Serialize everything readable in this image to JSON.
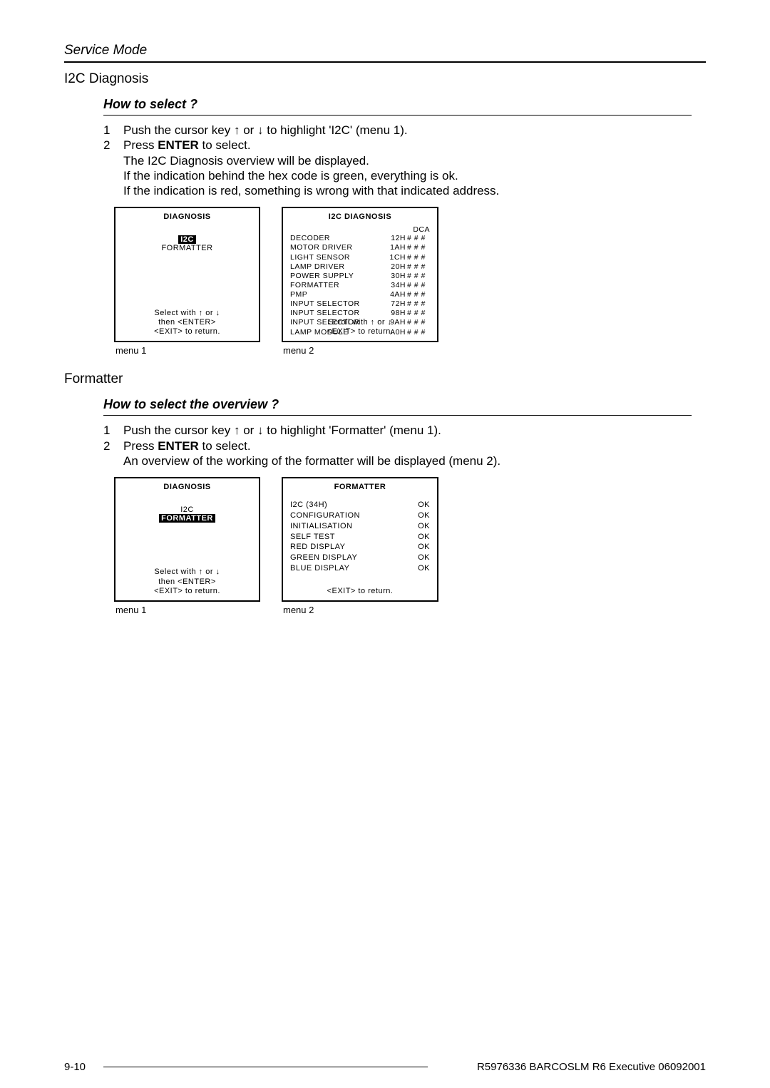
{
  "header": {
    "service_mode": "Service Mode"
  },
  "i2c": {
    "title": "I2C Diagnosis",
    "subheading": "How to select ?",
    "steps": {
      "s1_num": "1",
      "s1_pre": "Push the cursor key ",
      "s1_mid": " or ",
      "s1_post": " to highlight 'I2C' (menu 1).",
      "s2_num": "2",
      "s2_a": "Press ",
      "s2_enter": "ENTER",
      "s2_b": " to select.",
      "s2_line2": "The I2C Diagnosis overview will be displayed.",
      "s2_line3": "If the indication behind the hex code is green, everything is ok.",
      "s2_line4": "If the indication is red, something is wrong with that indicated address."
    },
    "menu1": {
      "title": "DIAGNOSIS",
      "item_sel": "I2C",
      "item2": "FORMATTER",
      "footer_l1_a": "Select with ",
      "footer_l1_b": " or ",
      "footer_l2": "then <ENTER>",
      "footer_l3": "<EXIT> to return.",
      "label": "menu 1"
    },
    "menu2": {
      "title": "I2C  DIAGNOSIS",
      "dca": "DCA",
      "rows": [
        {
          "name": "DECODER",
          "hex": "12H",
          "st": "# # #"
        },
        {
          "name": "MOTOR  DRIVER",
          "hex": "1AH",
          "st": "# # #"
        },
        {
          "name": "LIGHT  SENSOR",
          "hex": "1CH",
          "st": "# # #"
        },
        {
          "name": "LAMP  DRIVER",
          "hex": "20H",
          "st": "# # #"
        },
        {
          "name": "POWER  SUPPLY",
          "hex": "30H",
          "st": "# # #"
        },
        {
          "name": "FORMATTER",
          "hex": "34H",
          "st": "# # #"
        },
        {
          "name": "PMP",
          "hex": "4AH",
          "st": "# # #"
        },
        {
          "name": "INPUT  SELECTOR",
          "hex": "72H",
          "st": "# # #"
        },
        {
          "name": "INPUT  SELECTOR",
          "hex": "98H",
          "st": "# # #"
        },
        {
          "name": "INPUT  SELECTOR",
          "hex": "9AH",
          "st": "# # #"
        },
        {
          "name": "LAMP MODULE",
          "hex": "A0H",
          "st": "# # #"
        }
      ],
      "footer_l1_a": "Scroll with ",
      "footer_l1_b": " or ",
      "footer_l2": "<EXIT>  to  return.",
      "label": "menu 2"
    }
  },
  "formatter": {
    "title": "Formatter",
    "subheading": "How to select the overview ?",
    "steps": {
      "s1_num": "1",
      "s1_pre": "Push the cursor key ",
      "s1_mid": " or ",
      "s1_post": " to highlight 'Formatter' (menu 1).",
      "s2_num": "2",
      "s2_a": "Press ",
      "s2_enter": "ENTER",
      "s2_b": " to select.",
      "s2_line2": "An overview of the working of the formatter will be displayed (menu 2)."
    },
    "menu1": {
      "title": "DIAGNOSIS",
      "item1": "I2C",
      "item_sel": "FORMATTER",
      "footer_l1_a": "Select with ",
      "footer_l1_b": " or ",
      "footer_l2": "then <ENTER>",
      "footer_l3": "<EXIT> to return.",
      "label": "menu 1"
    },
    "menu2": {
      "title": "FORMATTER",
      "rows": [
        {
          "name": "I2C  (34H)",
          "st": "OK"
        },
        {
          "name": "CONFIGURATION",
          "st": "OK"
        },
        {
          "name": "INITIALISATION",
          "st": "OK"
        },
        {
          "name": "SELF  TEST",
          "st": "OK"
        },
        {
          "name": "RED  DISPLAY",
          "st": "OK"
        },
        {
          "name": "GREEN  DISPLAY",
          "st": "OK"
        },
        {
          "name": "BLUE  DISPLAY",
          "st": "OK"
        }
      ],
      "footer": "<EXIT>  to  return.",
      "label": "menu 2"
    }
  },
  "footer": {
    "page": "9-10",
    "docref": "R5976336 BARCOSLM R6 Executive 06092001"
  },
  "glyphs": {
    "up": "↑",
    "down": "↓"
  }
}
